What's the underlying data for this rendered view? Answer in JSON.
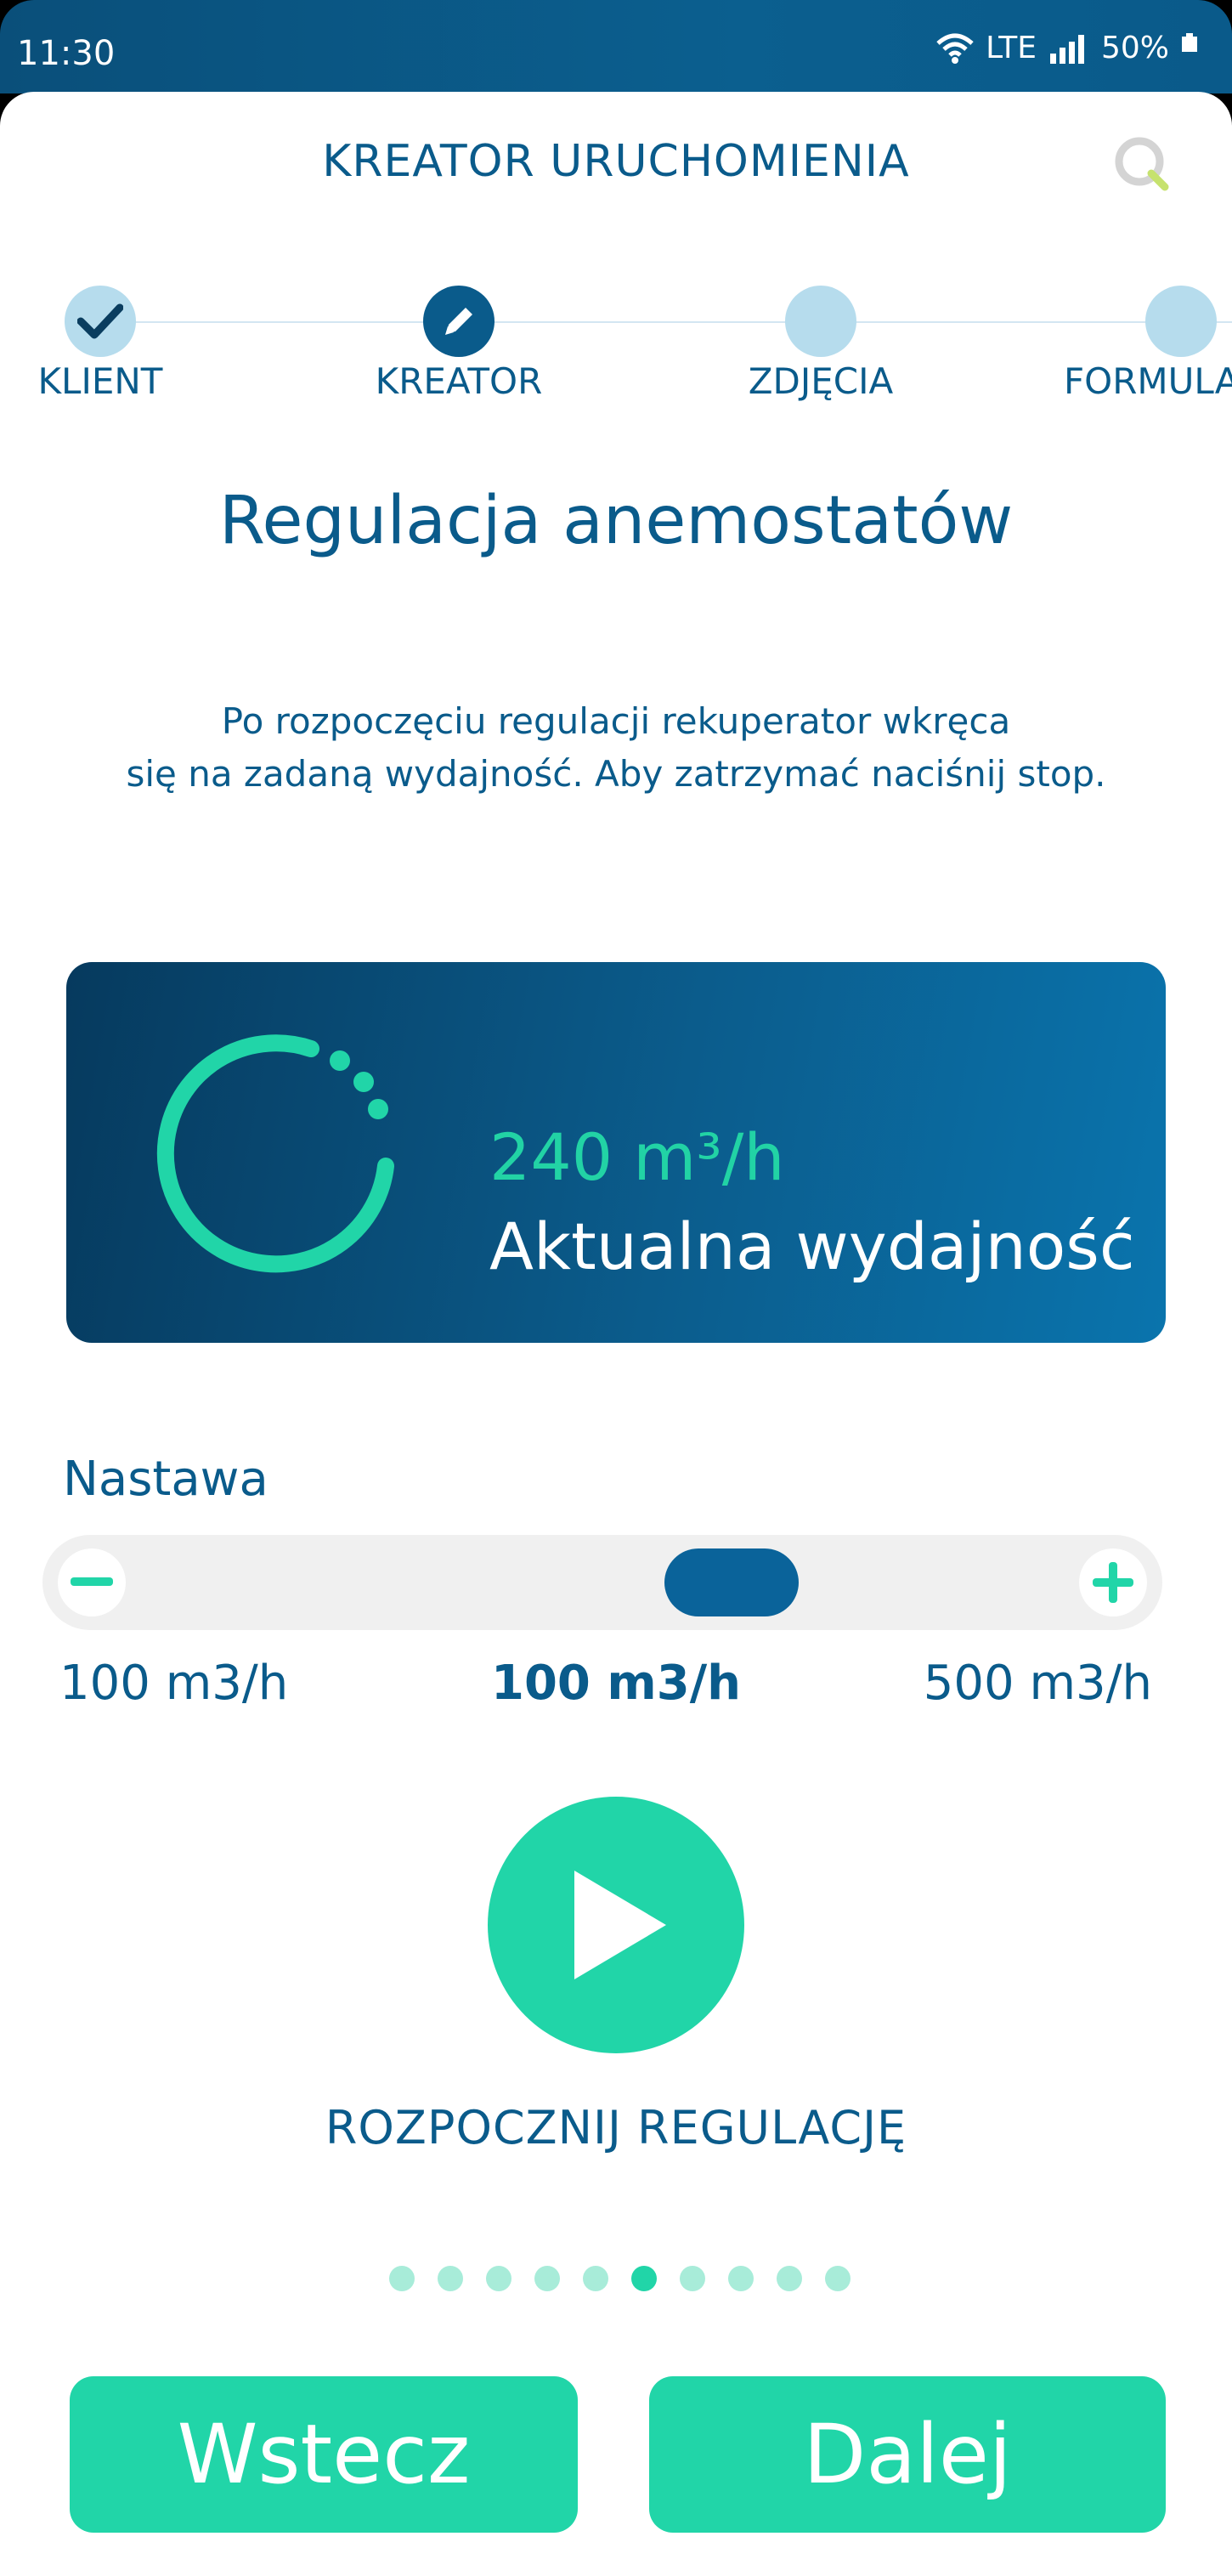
{
  "status_bar": {
    "time": "11:30",
    "network": "LTE",
    "battery": "50%"
  },
  "header": {
    "title": "KREATOR URUCHOMIENIA"
  },
  "stepper": {
    "steps": [
      {
        "label": "KLIENT",
        "state": "done"
      },
      {
        "label": "KREATOR",
        "state": "current"
      },
      {
        "label": "ZDJĘCIA",
        "state": "upcoming"
      },
      {
        "label": "FORMULA",
        "state": "upcoming"
      }
    ]
  },
  "page": {
    "title": "Regulacja anemostatów",
    "description_line1": "Po rozpoczęciu regulacji rekuperator wkręca",
    "description_line2": "się na zadaną wydajność. Aby zatrzymać naciśnij stop."
  },
  "capacity_card": {
    "value": "240 m³/h",
    "label": "Aktualna wydajność"
  },
  "setpoint": {
    "label": "Nastawa",
    "min_label": "100 m3/h",
    "current_label": "100 m3/h",
    "max_label": "500 m3/h"
  },
  "action": {
    "label": "ROZPOCZNIJ REGULACJĘ"
  },
  "pager": {
    "total": 10,
    "active_index": 5
  },
  "buttons": {
    "back": "Wstecz",
    "next": "Dalej"
  },
  "colors": {
    "primary": "#0a5b8b",
    "accent": "#21d5a8",
    "light_step": "#b6dced"
  }
}
